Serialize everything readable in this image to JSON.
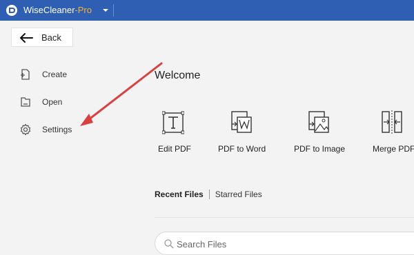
{
  "titlebar": {
    "app_name": "WiseCleaner",
    "app_suffix": "-Pro",
    "bg_color": "#2f5fb3",
    "suffix_color": "#f5b13a"
  },
  "back": {
    "label": "Back"
  },
  "sidebar": {
    "items": [
      {
        "label": "Create",
        "icon": "create-file-icon"
      },
      {
        "label": "Open",
        "icon": "folder-icon"
      },
      {
        "label": "Settings",
        "icon": "gear-icon"
      }
    ]
  },
  "main": {
    "welcome": "Welcome",
    "tools": [
      {
        "label": "Edit PDF",
        "icon": "edit-text-icon"
      },
      {
        "label": "PDF to Word",
        "icon": "pdf-to-word-icon"
      },
      {
        "label": "PDF to Image",
        "icon": "pdf-to-image-icon"
      },
      {
        "label": "Merge PDF",
        "icon": "merge-icon"
      }
    ],
    "tabs": [
      {
        "label": "Recent Files",
        "active": true
      },
      {
        "label": "Starred Files",
        "active": false
      }
    ],
    "search": {
      "placeholder": "Search Files"
    }
  },
  "annotation": {
    "arrow_color": "#d94040"
  }
}
